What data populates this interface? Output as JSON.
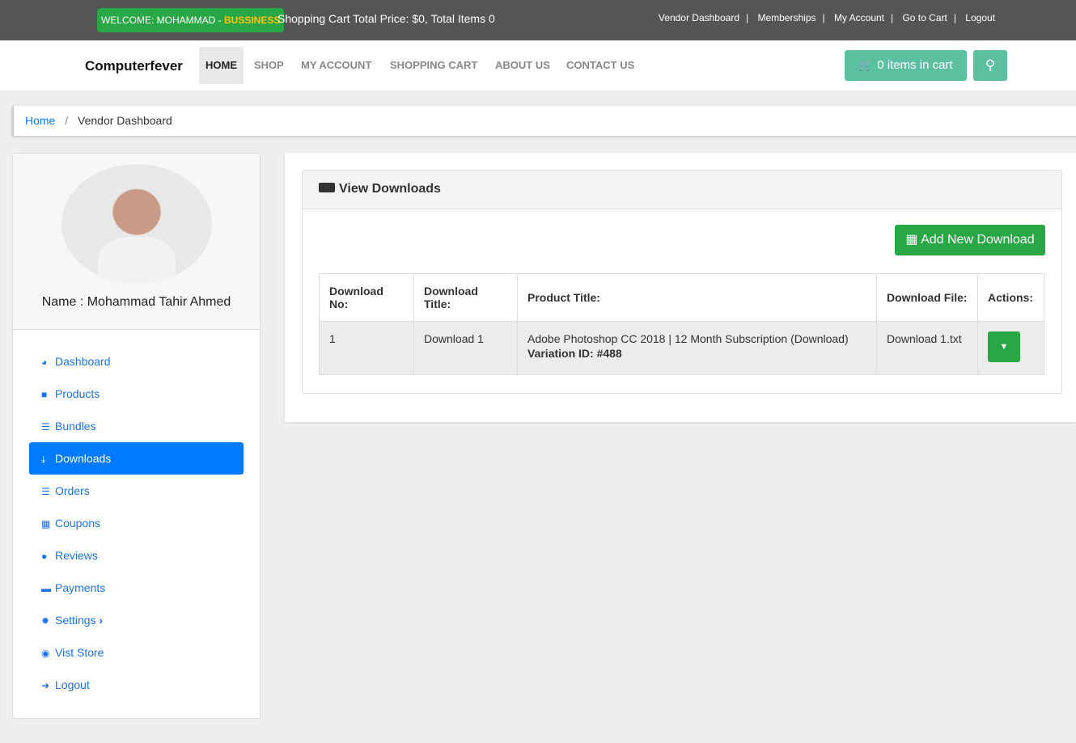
{
  "topbar": {
    "welcome": "WELCOME: MOHAMMAD - ",
    "role": "BUSSINESS",
    "cart_summary": "Shopping Cart Total Price: $0, Total Items 0",
    "links": [
      "Vendor Dashboard",
      "Memberships",
      "My Account",
      "Go to Cart",
      "Logout"
    ]
  },
  "nav": {
    "brand": "Computerfever",
    "items": [
      "HOME",
      "SHOP",
      "MY ACCOUNT",
      "SHOPPING CART",
      "ABOUT US",
      "CONTACT US"
    ],
    "cart_button": "0 items in cart"
  },
  "breadcrumb": {
    "home": "Home",
    "current": "Vendor Dashboard"
  },
  "sidebar": {
    "name": "Name : Mohammad Tahir Ahmed",
    "items": [
      {
        "label": "Dashboard",
        "icon": "tachometer-icon"
      },
      {
        "label": "Products",
        "icon": "briefcase-icon"
      },
      {
        "label": "Bundles",
        "icon": "tasks-icon"
      },
      {
        "label": "Downloads",
        "icon": "download-icon"
      },
      {
        "label": "Orders",
        "icon": "list-icon"
      },
      {
        "label": "Coupons",
        "icon": "gift-icon"
      },
      {
        "label": "Reviews",
        "icon": "comments-icon"
      },
      {
        "label": "Payments",
        "icon": "credit-card-icon"
      },
      {
        "label": "Settings",
        "icon": "gear-icon"
      },
      {
        "label": "Vist Store",
        "icon": "eye-icon"
      },
      {
        "label": "Logout",
        "icon": "sign-out-icon"
      }
    ]
  },
  "panel": {
    "title": "View Downloads",
    "add_button": "Add New Download",
    "columns": [
      "Download No:",
      "Download Title:",
      "Product Title:",
      "Download File:",
      "Actions:"
    ],
    "rows": [
      {
        "no": "1",
        "title": "Download 1",
        "product": "Adobe Photoshop CC 2018 | 12 Month Subscription (Download)",
        "variation": "Variation ID: #488",
        "file": "Download 1.txt"
      }
    ]
  },
  "colors": {
    "accent": "#007bff",
    "success": "#28a745",
    "teal": "#5bc0a0"
  }
}
